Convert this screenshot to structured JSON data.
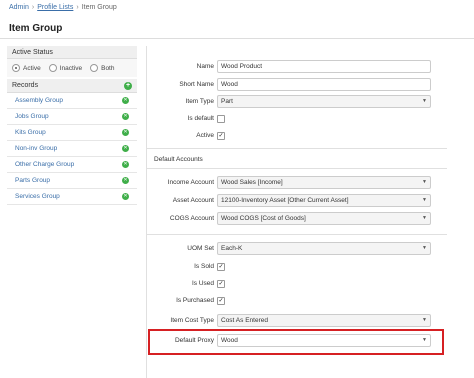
{
  "breadcrumb": {
    "admin": "Admin",
    "profile_lists": "Profile Lists",
    "current": "Item Group",
    "sep": "›"
  },
  "page_title": "Item Group",
  "sidebar": {
    "active_status_title": "Active Status",
    "status_options": [
      "Active",
      "Inactive",
      "Both"
    ],
    "records_title": "Records",
    "records": [
      "Assembly Group",
      "Jobs Group",
      "Kits Group",
      "Non-inv Group",
      "Other Charge Group",
      "Parts Group",
      "Services Group"
    ]
  },
  "form": {
    "name_label": "Name",
    "name_value": "Wood Product",
    "short_name_label": "Short Name",
    "short_name_value": "Wood",
    "item_type_label": "Item Type",
    "item_type_value": "Part",
    "is_default_label": "Is default",
    "active_label": "Active",
    "default_accounts_title": "Default Accounts",
    "income_label": "Income Account",
    "income_value": "Wood Sales [Income]",
    "asset_label": "Asset Account",
    "asset_value": "12100-Inventory Asset [Other Current Asset]",
    "cogs_label": "COGS Account",
    "cogs_value": "Wood COGS [Cost of Goods]",
    "uom_label": "UOM Set",
    "uom_value": "Each-K",
    "is_sold_label": "Is Sold",
    "is_used_label": "Is Used",
    "is_purchased_label": "Is Purchased",
    "cost_type_label": "Item Cost Type",
    "cost_type_value": "Cost As Entered",
    "proxy_label": "Default Proxy",
    "proxy_value": "Wood"
  },
  "check_mark": "✓",
  "caret": "▼",
  "plus": "+",
  "x": "✕",
  "colors": {
    "link": "#3a6ea8",
    "icon_green": "#3fae49",
    "highlight_red": "#d62023"
  }
}
